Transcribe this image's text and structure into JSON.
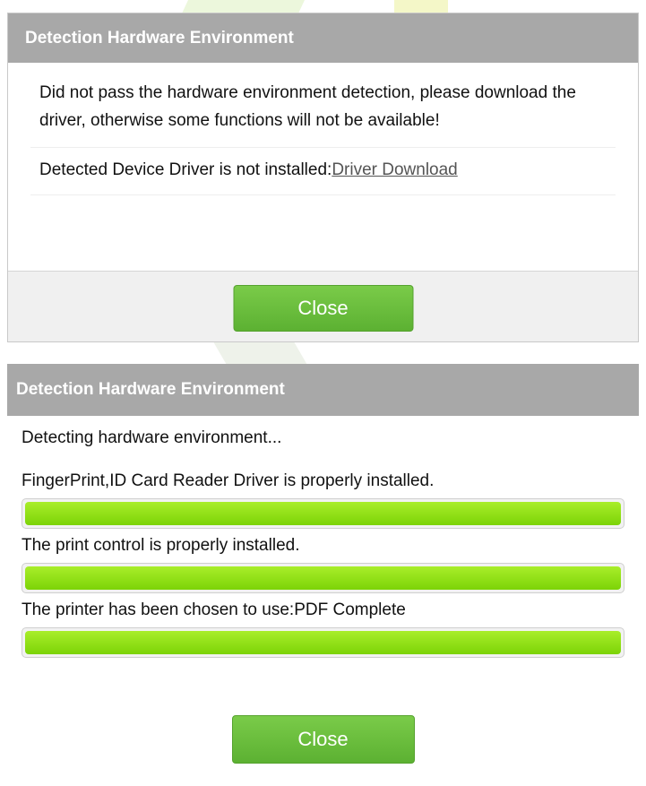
{
  "dialog1": {
    "title": "Detection Hardware Environment",
    "message": "Did not pass the hardware environment detection, please download the driver, otherwise some functions will not be available!",
    "detected_text": "Detected Device Driver is not installed:",
    "driver_link": "Driver Download",
    "close_label": "Close"
  },
  "dialog2": {
    "title": "Detection Hardware Environment",
    "detecting_text": "Detecting hardware environment...",
    "checks": [
      {
        "text": "FingerPrint,ID Card Reader Driver is properly installed.",
        "progress": 1.0
      },
      {
        "text": "The print control is properly installed.",
        "progress": 1.0
      },
      {
        "text": "The printer has been chosen to use:PDF Complete",
        "progress": 1.0
      }
    ],
    "close_label": "Close"
  },
  "colors": {
    "header_bg": "#a8a8a8",
    "button_green": "#6cbf3f",
    "progress_green": "#8fe014"
  }
}
